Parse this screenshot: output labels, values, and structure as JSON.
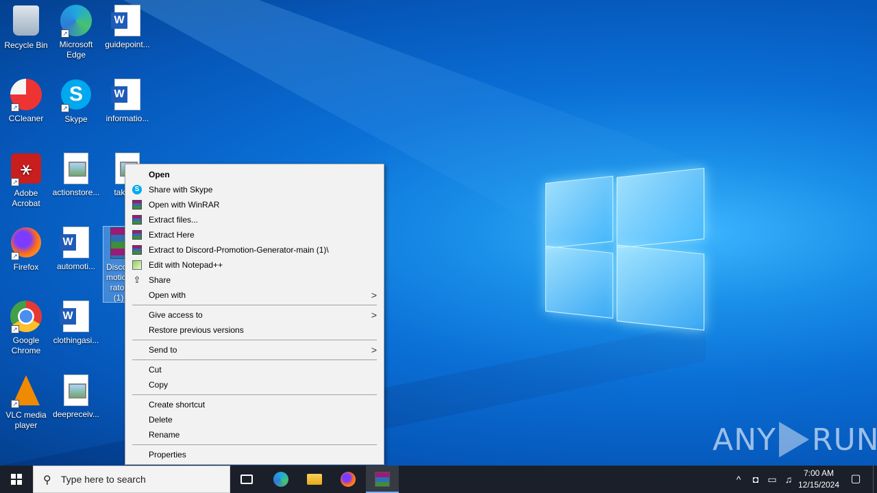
{
  "desktop": {
    "icons": [
      {
        "label": "Recycle Bin"
      },
      {
        "label": "Microsoft Edge"
      },
      {
        "label": "guidepoint..."
      },
      {
        "label": "CCleaner"
      },
      {
        "label": "Skype"
      },
      {
        "label": "informatio..."
      },
      {
        "label": "Adobe Acrobat"
      },
      {
        "label": "actionstore..."
      },
      {
        "label": "taken..."
      },
      {
        "label": "Firefox"
      },
      {
        "label": "automoti..."
      },
      {
        "label": "Disco... motio... rator (1)"
      },
      {
        "label": "Google Chrome"
      },
      {
        "label": "clothingasi..."
      },
      {
        "label": "VLC media player"
      },
      {
        "label": "deepreceiv..."
      }
    ]
  },
  "context_menu": {
    "items": [
      {
        "label": "Open",
        "icon": "none"
      },
      {
        "label": "Share with Skype",
        "icon": "skype-icon"
      },
      {
        "label": "Open with WinRAR",
        "icon": "winrar-icon"
      },
      {
        "label": "Extract files...",
        "icon": "winrar-icon"
      },
      {
        "label": "Extract Here",
        "icon": "winrar-icon"
      },
      {
        "label": "Extract to Discord-Promotion-Generator-main (1)\\",
        "icon": "winrar-icon"
      },
      {
        "label": "Edit with Notepad++",
        "icon": "notepadpp-icon"
      },
      {
        "label": "Share",
        "icon": "share-icon"
      },
      {
        "label": "Open with",
        "icon": "none"
      },
      {
        "label": "Give access to",
        "icon": "none"
      },
      {
        "label": "Restore previous versions",
        "icon": "none"
      },
      {
        "label": "Send to",
        "icon": "none"
      },
      {
        "label": "Cut",
        "icon": "none"
      },
      {
        "label": "Copy",
        "icon": "none"
      },
      {
        "label": "Create shortcut",
        "icon": "none"
      },
      {
        "label": "Delete",
        "icon": "none"
      },
      {
        "label": "Rename",
        "icon": "none"
      },
      {
        "label": "Properties",
        "icon": "none"
      }
    ],
    "submenu_arrow": ">"
  },
  "taskbar": {
    "search_placeholder": "Type here to search",
    "tray_chevron": "^",
    "clock_time": "7:00 AM",
    "clock_date": "12/15/2024"
  },
  "watermark": {
    "left": "ANY",
    "right": "RUN"
  }
}
